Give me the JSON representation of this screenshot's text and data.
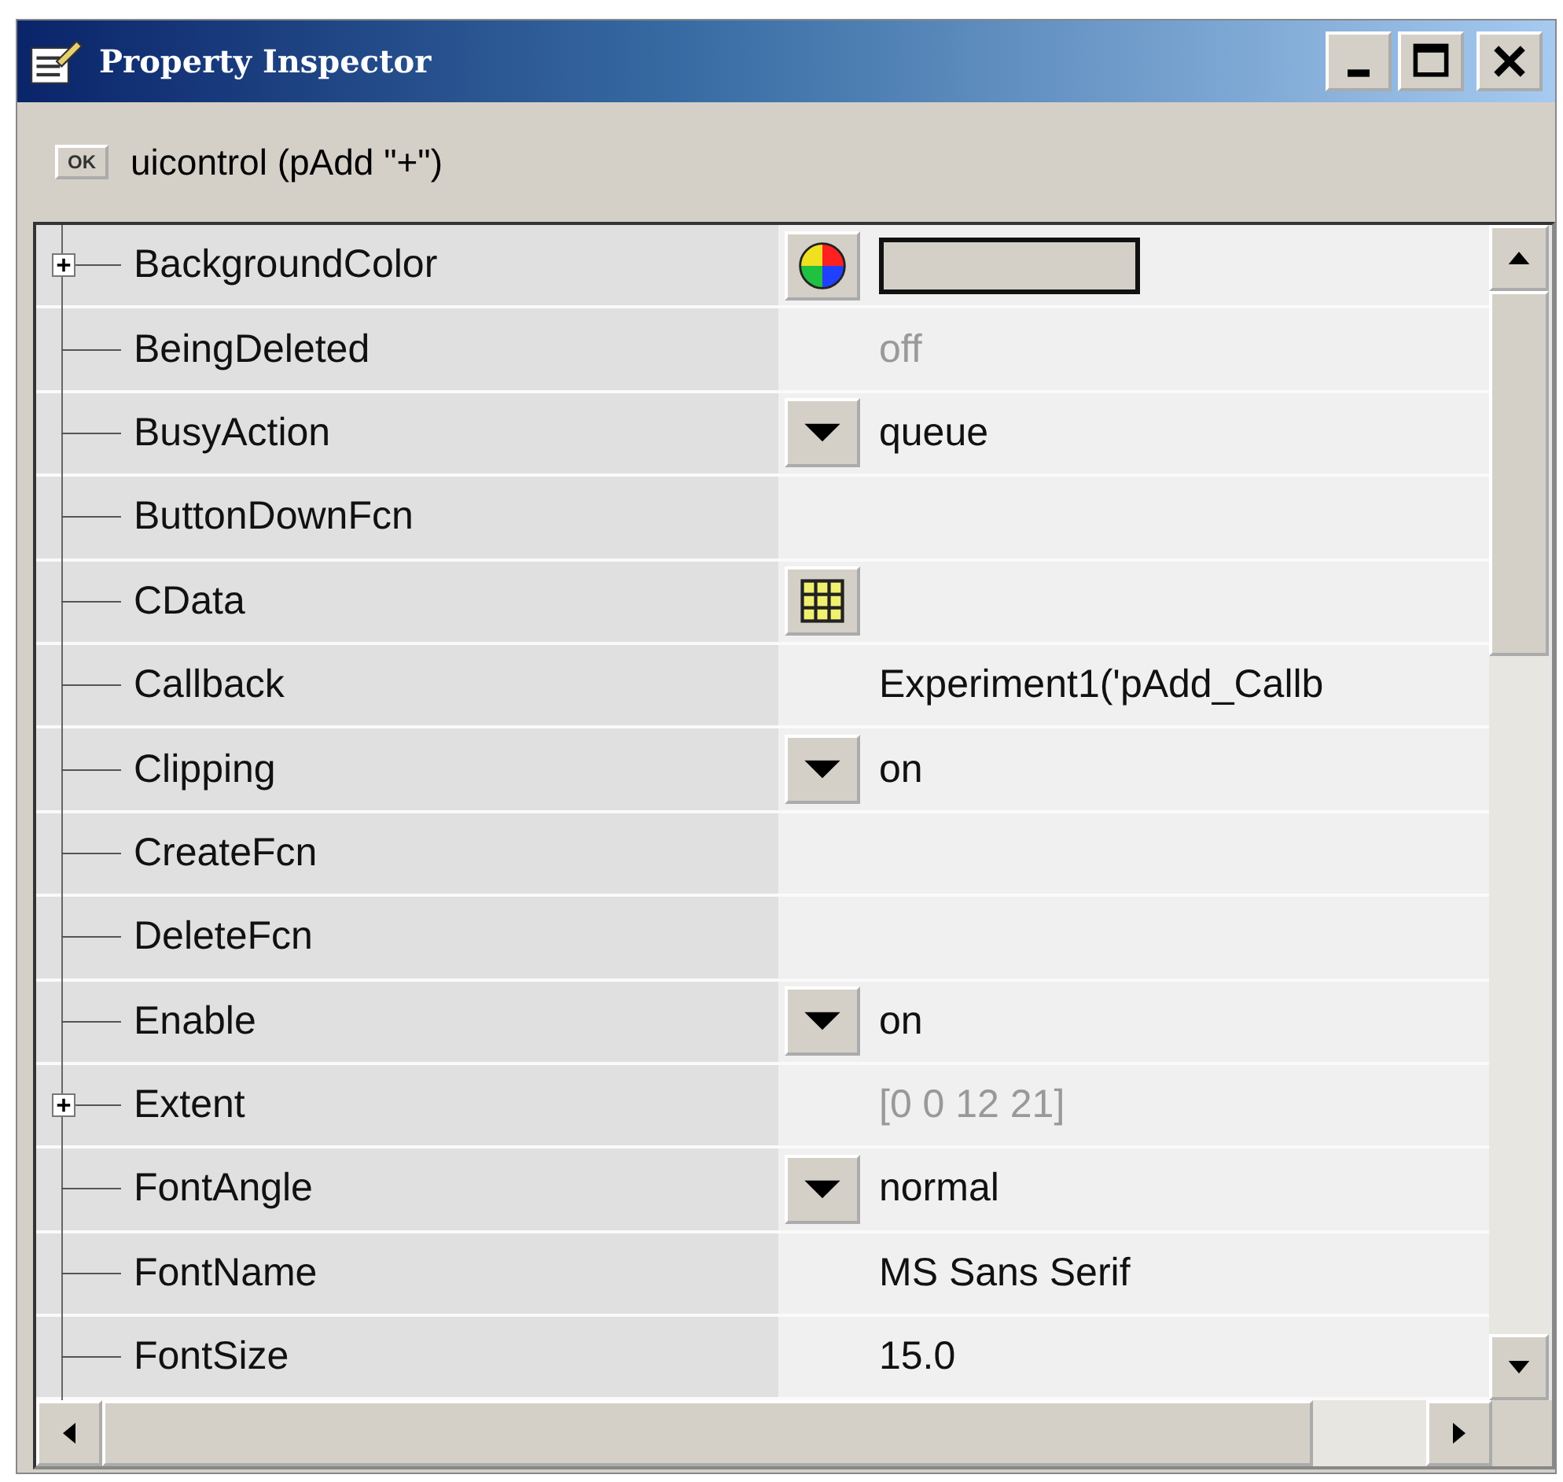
{
  "window": {
    "title": "Property Inspector"
  },
  "object": {
    "badge": "OK",
    "label": "uicontrol (pAdd \"+\")"
  },
  "properties": [
    {
      "name": "BackgroundColor",
      "kind": "color",
      "expanded": false
    },
    {
      "name": "BeingDeleted",
      "kind": "text",
      "value": "off",
      "disabled": true
    },
    {
      "name": "BusyAction",
      "kind": "dropdown",
      "value": "queue",
      "disabled": false
    },
    {
      "name": "ButtonDownFcn",
      "kind": "text"
    },
    {
      "name": "CData",
      "kind": "grid"
    },
    {
      "name": "Callback",
      "kind": "text",
      "value": "Experiment1('pAdd_Callb",
      "disabled": false
    },
    {
      "name": "Clipping",
      "kind": "dropdown",
      "value": "on",
      "disabled": false
    },
    {
      "name": "CreateFcn",
      "kind": "text"
    },
    {
      "name": "DeleteFcn",
      "kind": "text"
    },
    {
      "name": "Enable",
      "kind": "dropdown",
      "value": "on",
      "disabled": false
    },
    {
      "name": "Extent",
      "kind": "text",
      "value": "[0 0 12 21]",
      "expanded": false,
      "disabled": true
    },
    {
      "name": "FontAngle",
      "kind": "dropdown",
      "value": "normal",
      "disabled": false
    },
    {
      "name": "FontName",
      "kind": "text",
      "value": "MS Sans Serif",
      "disabled": false
    },
    {
      "name": "FontSize",
      "kind": "text",
      "value": "15.0",
      "disabled": false
    }
  ]
}
